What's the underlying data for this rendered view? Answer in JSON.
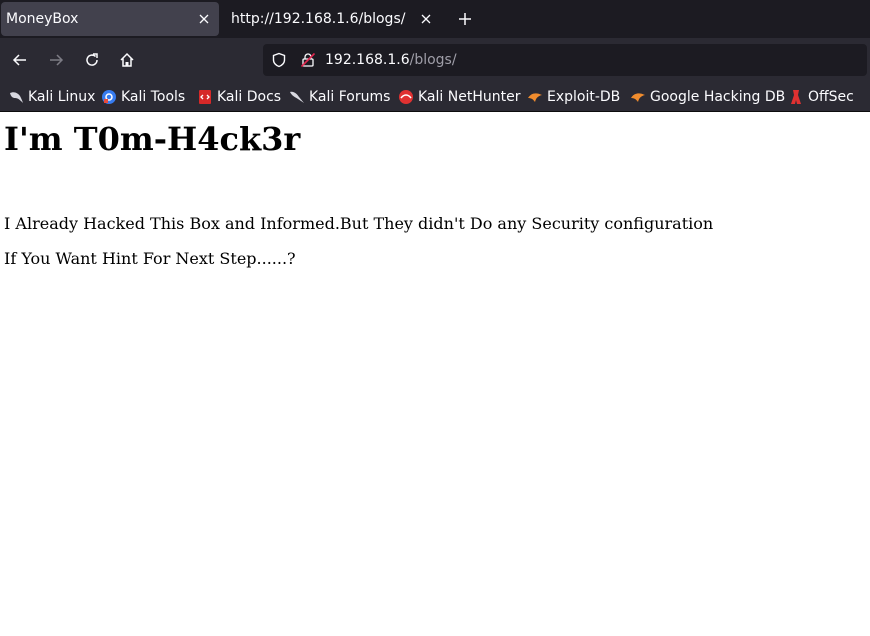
{
  "tabs": [
    {
      "title": "MoneyBox",
      "active": true
    },
    {
      "title": "http://192.168.1.6/blogs/",
      "active": false
    }
  ],
  "urlbar": {
    "host": "192.168.1.6",
    "path": "/blogs/"
  },
  "bookmarks": [
    {
      "label": "Kali Linux",
      "icon": "kali-dragon-icon"
    },
    {
      "label": "Kali Tools",
      "icon": "kali-tools-icon"
    },
    {
      "label": "Kali Docs",
      "icon": "kali-docs-icon"
    },
    {
      "label": "Kali Forums",
      "icon": "kali-forums-icon"
    },
    {
      "label": "Kali NetHunter",
      "icon": "nethunter-icon"
    },
    {
      "label": "Exploit-DB",
      "icon": "exploit-db-icon"
    },
    {
      "label": "Google Hacking DB",
      "icon": "ghdb-icon"
    },
    {
      "label": "OffSec",
      "icon": "offsec-icon"
    }
  ],
  "page": {
    "heading": "I'm T0m-H4ck3r",
    "paragraphs": [
      "I Already Hacked This Box and Informed.But They didn't Do any Security configuration",
      "If You Want Hint For Next Step......?"
    ]
  },
  "colors": {
    "tab_strip": "#1c1b22",
    "toolbar": "#2b2a33",
    "active_tab": "#42414d",
    "url_field": "#1c1b22",
    "text_light": "#fbfbfe",
    "url_path": "#9f9ea8"
  }
}
